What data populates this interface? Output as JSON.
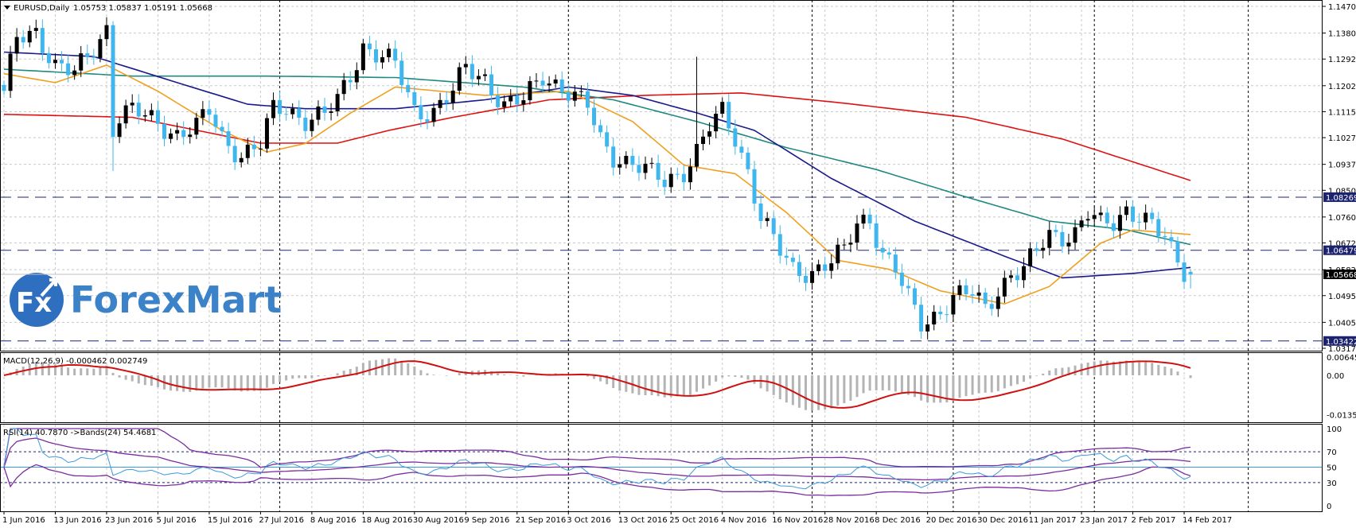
{
  "header": {
    "symbol_label": "EURUSD,Daily",
    "ohlc_text": "1.05753 1.05837 1.05191 1.05668"
  },
  "macd_label": "MACD(12,26,9) -0.000462 0.002749",
  "rsi_label": "RSI(14) 40.7870  ->Bands(24) 54.4681",
  "logo": {
    "mark": "Fx",
    "name": "ForexMart"
  },
  "colors": {
    "bull": "#000000",
    "bear": "#3fb7ee",
    "ma20": "#f0a020",
    "ma50": "#1a1a8c",
    "ma100": "#1f8a80",
    "ma200": "#e01010",
    "macd_hist": "#b4b4b4",
    "macd_signal": "#d01010",
    "rsi": "#3a9ad9",
    "bands": "#7b2ca0",
    "tag_bg": "#1b2370"
  },
  "chart_data": {
    "type": "candlestick",
    "title": "EURUSD,Daily",
    "price_ticks": [
      "1.14700",
      "1.13800",
      "1.12925",
      "1.12025",
      "1.11150",
      "1.10275",
      "1.09375",
      "1.08500",
      "1.07600",
      "1.06725",
      "1.05825",
      "1.04950",
      "1.04050",
      "1.03175"
    ],
    "price_range": [
      1.03175,
      1.147
    ],
    "date_labels": [
      "1 Jun 2016",
      "13 Jun 2016",
      "23 Jun 2016",
      "5 Jul 2016",
      "15 Jul 2016",
      "27 Jul 2016",
      "8 Aug 2016",
      "18 Aug 2016",
      "30 Aug 2016",
      "9 Sep 2016",
      "21 Sep 2016",
      "3 Oct 2016",
      "13 Oct 2016",
      "25 Oct 2016",
      "4 Nov 2016",
      "16 Nov 2016",
      "28 Nov 2016",
      "8 Dec 2016",
      "20 Dec 2016",
      "30 Dec 2016",
      "11 Jan 2017",
      "23 Jan 2017",
      "2 Feb 2017",
      "14 Feb 2017"
    ],
    "bars_per_date_label": 8,
    "close_keypoints": [
      [
        0,
        1.117
      ],
      [
        2,
        1.136
      ],
      [
        5,
        1.139
      ],
      [
        8,
        1.127
      ],
      [
        11,
        1.124
      ],
      [
        14,
        1.133
      ],
      [
        16,
        1.14
      ],
      [
        17,
        1.106
      ],
      [
        18,
        1.11
      ],
      [
        20,
        1.1115
      ],
      [
        24,
        1.108
      ],
      [
        27,
        1.104
      ],
      [
        30,
        1.106
      ],
      [
        32,
        1.1115
      ],
      [
        34,
        1.103
      ],
      [
        37,
        1.097
      ],
      [
        40,
        1.1
      ],
      [
        42,
        1.112
      ],
      [
        44,
        1.113
      ],
      [
        47,
        1.109
      ],
      [
        50,
        1.11
      ],
      [
        52,
        1.115
      ],
      [
        54,
        1.124
      ],
      [
        56,
        1.134
      ],
      [
        58,
        1.131
      ],
      [
        61,
        1.127
      ],
      [
        64,
        1.112
      ],
      [
        67,
        1.112
      ],
      [
        70,
        1.118
      ],
      [
        72,
        1.126
      ],
      [
        75,
        1.123
      ],
      [
        78,
        1.1135
      ],
      [
        81,
        1.115
      ],
      [
        84,
        1.124
      ],
      [
        87,
        1.12
      ],
      [
        89,
        1.116
      ],
      [
        91,
        1.113
      ],
      [
        93,
        1.102
      ],
      [
        95,
        1.097
      ],
      [
        98,
        1.094
      ],
      [
        101,
        1.09
      ],
      [
        103,
        1.088
      ],
      [
        106,
        1.092
      ],
      [
        108,
        1.098
      ],
      [
        110,
        1.106
      ],
      [
        112,
        1.111
      ],
      [
        114,
        1.103
      ],
      [
        116,
        1.092
      ],
      [
        118,
        1.076
      ],
      [
        121,
        1.064
      ],
      [
        123,
        1.058
      ],
      [
        126,
        1.058
      ],
      [
        129,
        1.061
      ],
      [
        131,
        1.064
      ],
      [
        133,
        1.074
      ],
      [
        135,
        1.076
      ],
      [
        137,
        1.064
      ],
      [
        139,
        1.058
      ],
      [
        141,
        1.048
      ],
      [
        143,
        1.04
      ],
      [
        145,
        1.043
      ],
      [
        148,
        1.049
      ],
      [
        151,
        1.05
      ],
      [
        153,
        1.045
      ],
      [
        155,
        1.052
      ],
      [
        157,
        1.057
      ],
      [
        159,
        1.058
      ],
      [
        161,
        1.064
      ],
      [
        163,
        1.07
      ],
      [
        165,
        1.07
      ],
      [
        167,
        1.071
      ],
      [
        169,
        1.077
      ],
      [
        171,
        1.073
      ],
      [
        173,
        1.074
      ],
      [
        175,
        1.079
      ],
      [
        177,
        1.077
      ],
      [
        179,
        1.073
      ],
      [
        181,
        1.068
      ],
      [
        182,
        1.064
      ],
      [
        183,
        1.061
      ],
      [
        184,
        1.058
      ],
      [
        185,
        1.05668
      ]
    ],
    "last_bar": {
      "open": 1.05753,
      "high": 1.05837,
      "low": 1.05191,
      "close": 1.05668
    },
    "moving_averages": [
      {
        "name": "ma200",
        "points": [
          [
            0,
            1.1106
          ],
          [
            20,
            1.1096
          ],
          [
            40,
            1.1009
          ],
          [
            52,
            1.1009
          ],
          [
            60,
            1.1052
          ],
          [
            70,
            1.1096
          ],
          [
            85,
            1.1155
          ],
          [
            100,
            1.117
          ],
          [
            115,
            1.1178
          ],
          [
            130,
            1.1146
          ],
          [
            150,
            1.1096
          ],
          [
            165,
            1.1023
          ],
          [
            185,
            1.0883
          ]
        ]
      },
      {
        "name": "ma100",
        "points": [
          [
            0,
            1.1258
          ],
          [
            20,
            1.1235
          ],
          [
            41,
            1.1235
          ],
          [
            61,
            1.123
          ],
          [
            81,
            1.1198
          ],
          [
            95,
            1.1155
          ],
          [
            108,
            1.1082
          ],
          [
            122,
            1.0994
          ],
          [
            136,
            1.092
          ],
          [
            149,
            1.0834
          ],
          [
            163,
            1.0746
          ],
          [
            175,
            1.0717
          ],
          [
            185,
            1.0667
          ]
        ]
      },
      {
        "name": "ma50",
        "points": [
          [
            0,
            1.1316
          ],
          [
            14,
            1.1301
          ],
          [
            27,
            1.1213
          ],
          [
            38,
            1.114
          ],
          [
            47,
            1.1125
          ],
          [
            61,
            1.1125
          ],
          [
            75,
            1.1155
          ],
          [
            88,
            1.1198
          ],
          [
            98,
            1.117
          ],
          [
            108,
            1.1111
          ],
          [
            117,
            1.1052
          ],
          [
            129,
            1.089
          ],
          [
            142,
            1.0746
          ],
          [
            156,
            1.0628
          ],
          [
            165,
            1.0555
          ],
          [
            176,
            1.057
          ],
          [
            185,
            1.059
          ]
        ]
      },
      {
        "name": "ma20",
        "points": [
          [
            0,
            1.1243
          ],
          [
            8,
            1.1213
          ],
          [
            16,
            1.1272
          ],
          [
            24,
            1.1184
          ],
          [
            34,
            1.1052
          ],
          [
            41,
            1.0979
          ],
          [
            47,
            1.1008
          ],
          [
            54,
            1.111
          ],
          [
            61,
            1.1198
          ],
          [
            75,
            1.117
          ],
          [
            88,
            1.1184
          ],
          [
            98,
            1.1082
          ],
          [
            106,
            1.0935
          ],
          [
            114,
            1.0906
          ],
          [
            122,
            1.0775
          ],
          [
            130,
            1.0614
          ],
          [
            138,
            1.0584
          ],
          [
            146,
            1.0511
          ],
          [
            156,
            1.0467
          ],
          [
            163,
            1.0526
          ],
          [
            171,
            1.0672
          ],
          [
            176,
            1.0716
          ],
          [
            185,
            1.0701
          ]
        ]
      }
    ],
    "horizontal_levels": [
      {
        "value": 1.08269,
        "label": "1.08269"
      },
      {
        "value": 1.06479,
        "label": "1.06479"
      },
      {
        "value": 1.03422,
        "label": "1.03422"
      }
    ],
    "current_price": {
      "value": 1.05668,
      "label": "1.05668"
    },
    "macd": {
      "params": [
        12,
        26,
        9
      ],
      "ticks": [
        "0.006457",
        "0.00",
        "-0.01352"
      ],
      "tick_values": [
        0.006457,
        0,
        -0.01352
      ]
    },
    "rsi": {
      "period": 14,
      "bands_period": 24,
      "ticks": [
        "100",
        "70",
        "50",
        "30",
        "0"
      ],
      "tick_values": [
        100,
        70,
        50,
        30,
        0
      ]
    }
  }
}
